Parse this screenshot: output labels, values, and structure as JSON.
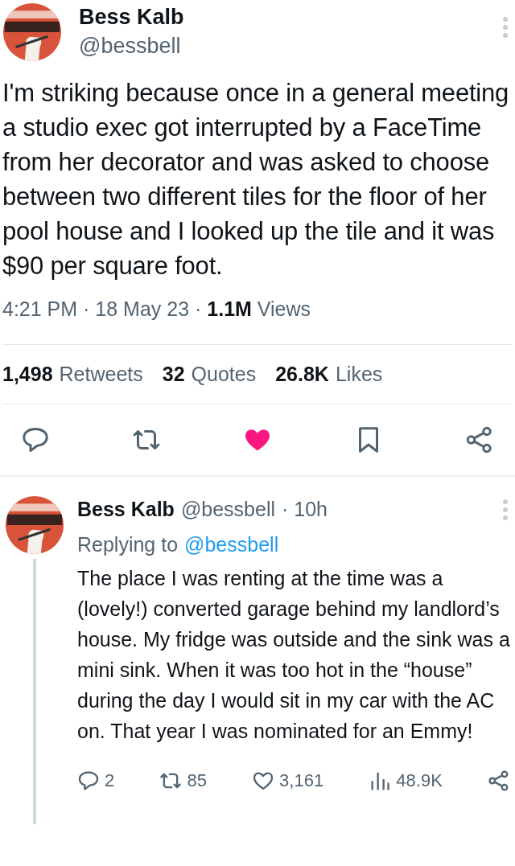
{
  "tweet": {
    "author": "Bess Kalb",
    "handle": "@bessbell",
    "text": "I'm striking because once in a general meeting a studio exec got interrupted by a FaceTime from her decorator and was asked to choose between two different tiles for the floor of her pool house and I looked up the tile and it was $90 per square foot.",
    "timestamp": "4:21 PM · 18 May 23 · ",
    "views_count": "1.1M",
    "views_label": "Views",
    "stats": [
      {
        "count": "1,498",
        "label": "Retweets"
      },
      {
        "count": "32",
        "label": "Quotes"
      },
      {
        "count": "26.8K",
        "label": "Likes"
      }
    ],
    "actions": [
      {
        "kind": "reply"
      },
      {
        "kind": "retweet"
      },
      {
        "kind": "like",
        "liked": true
      },
      {
        "kind": "bookmark"
      },
      {
        "kind": "share"
      }
    ]
  },
  "reply": {
    "author": "Bess Kalb",
    "handle": "@bessbell",
    "time": "· 10h",
    "replying_label": "Replying to",
    "replying_handle": "@bessbell",
    "text": "The place I was renting at the time was a (lovely!) converted garage behind my landlord’s house. My fridge was outside and the sink was a mini sink. When it was too hot in the “house” during the day I would sit in my car with the AC on. That year I was nominated for an Emmy!",
    "footer": [
      {
        "kind": "reply",
        "count": "2"
      },
      {
        "kind": "retweet",
        "count": "85"
      },
      {
        "kind": "like",
        "count": "3,161",
        "liked": false
      },
      {
        "kind": "views",
        "count": "48.9K"
      },
      {
        "kind": "share"
      }
    ]
  }
}
